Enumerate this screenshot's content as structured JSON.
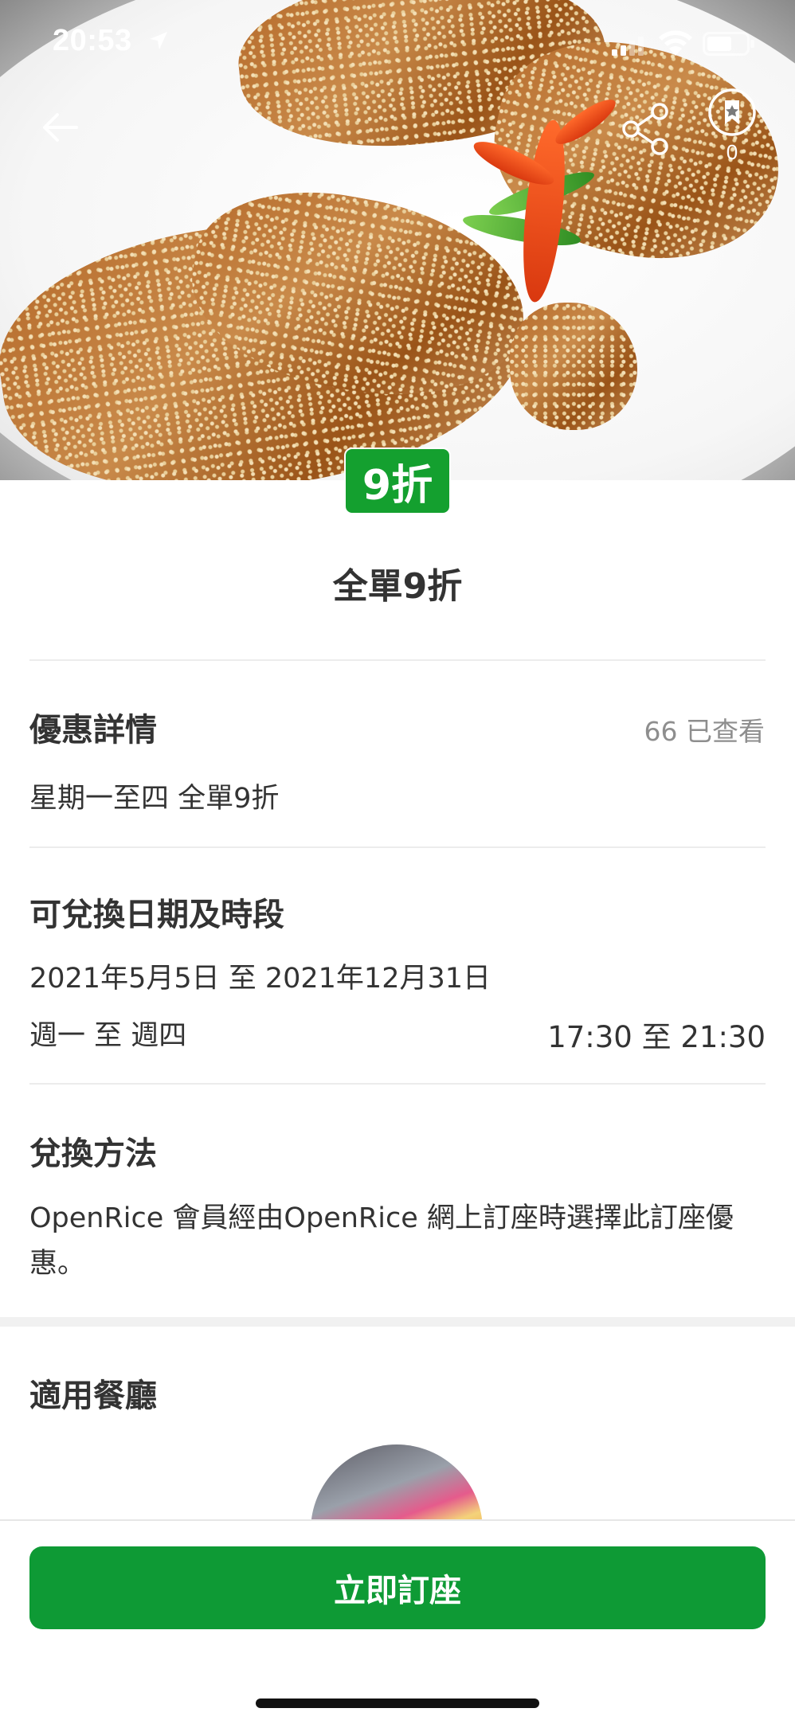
{
  "status_bar": {
    "time": "20:53"
  },
  "hero": {
    "bookmark_count": "0"
  },
  "offer": {
    "badge": "9折",
    "title": "全單9折"
  },
  "details": {
    "heading": "優惠詳情",
    "views": "66 已查看",
    "description": "星期一至四 全單9折"
  },
  "redeem_period": {
    "heading": "可兌換日期及時段",
    "date_range": "2021年5月5日 至 2021年12月31日",
    "days": "週一 至 週四",
    "time_range": "17:30 至 21:30"
  },
  "redeem_method": {
    "heading": "兌換方法",
    "text": "OpenRice 會員經由OpenRice 網上訂座時選擇此訂座優惠。"
  },
  "restaurants": {
    "heading": "適用餐廳"
  },
  "footer": {
    "book_button": "立即訂座"
  },
  "colors": {
    "accent_green": "#0e9a35",
    "badge_green": "#14a02f"
  }
}
